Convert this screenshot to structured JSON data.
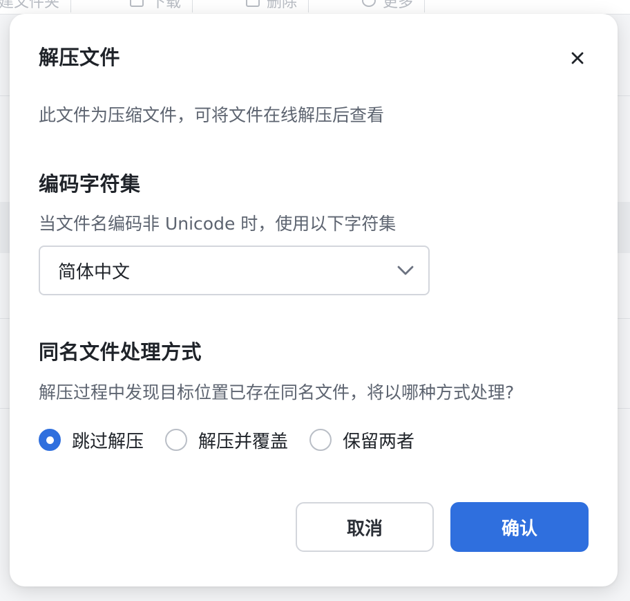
{
  "background": {
    "toolbar": [
      {
        "label": "新建文件夹",
        "icon": "folder-icon"
      },
      {
        "label": "下载",
        "icon": "download-icon"
      },
      {
        "label": "删除",
        "icon": "delete-icon"
      },
      {
        "label": "更多",
        "icon": "more-icon"
      }
    ]
  },
  "dialog": {
    "title": "解压文件",
    "close_icon": "close-icon",
    "description": "此文件为压缩文件，可将文件在线解压后查看",
    "encoding": {
      "title": "编码字符集",
      "hint": "当文件名编码非 Unicode 时，使用以下字符集",
      "selected": "简体中文",
      "chevron_icon": "chevron-down-icon"
    },
    "conflict": {
      "title": "同名文件处理方式",
      "hint": "解压过程中发现目标位置已存在同名文件，将以哪种方式处理?",
      "options": [
        {
          "label": "跳过解压",
          "checked": true
        },
        {
          "label": "解压并覆盖",
          "checked": false
        },
        {
          "label": "保留两者",
          "checked": false
        }
      ]
    },
    "buttons": {
      "cancel": "取消",
      "confirm": "确认"
    }
  },
  "colors": {
    "accent": "#2f6fde",
    "text_primary": "#1f2329",
    "text_secondary": "#5d6470",
    "border": "#d3d6dc"
  }
}
